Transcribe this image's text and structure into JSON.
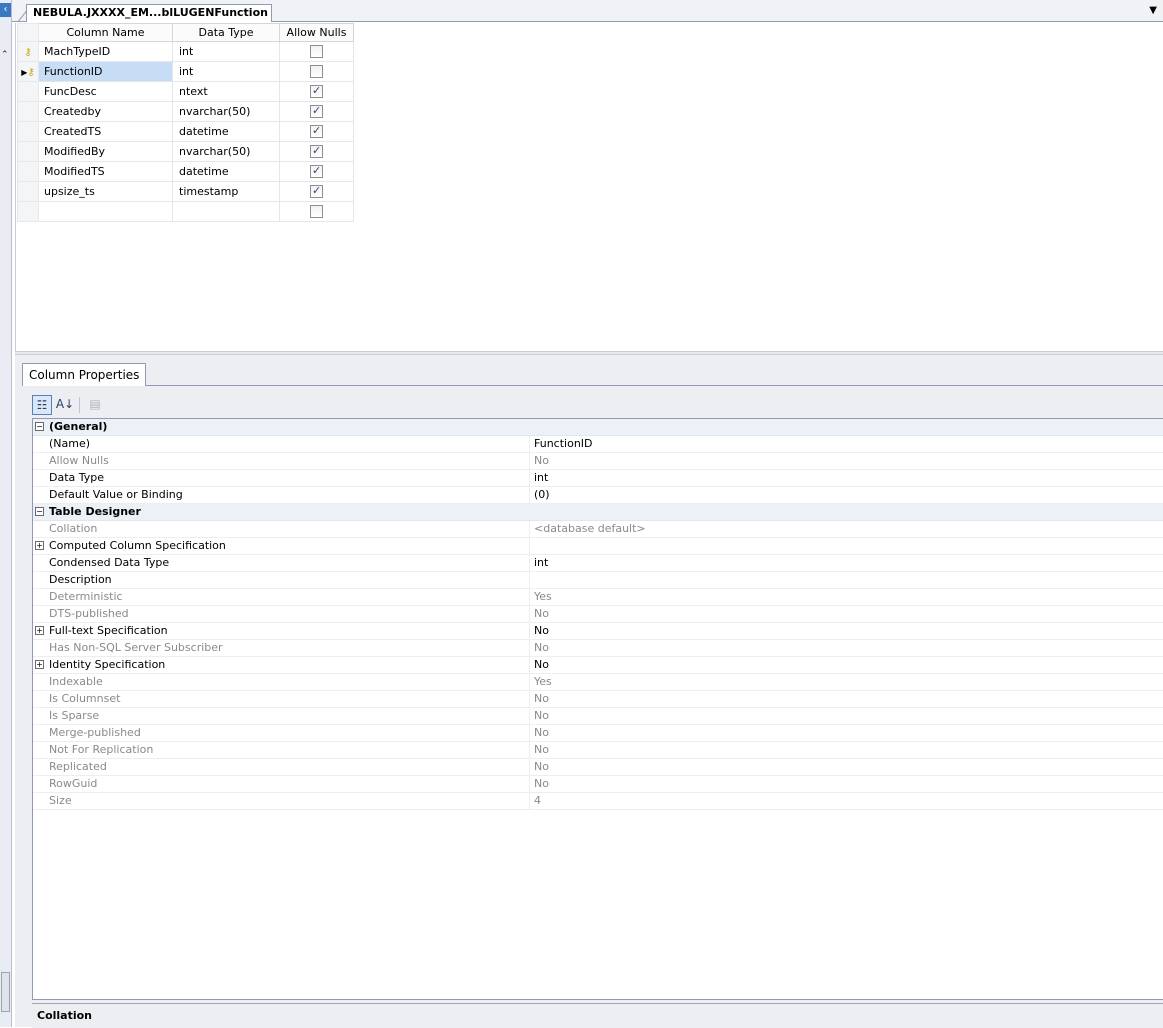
{
  "document_tab": {
    "title": "NEBULA.JXXXX_EM...blLUGENFunction"
  },
  "designer": {
    "headers": [
      "Column Name",
      "Data Type",
      "Allow Nulls"
    ],
    "rows": [
      {
        "marker": "key",
        "name": "MachTypeID",
        "type": "int",
        "allow_nulls": false
      },
      {
        "marker": "current-key",
        "name": "FunctionID",
        "type": "int",
        "allow_nulls": false
      },
      {
        "marker": "",
        "name": "FuncDesc",
        "type": "ntext",
        "allow_nulls": true
      },
      {
        "marker": "",
        "name": "Createdby",
        "type": "nvarchar(50)",
        "allow_nulls": true
      },
      {
        "marker": "",
        "name": "CreatedTS",
        "type": "datetime",
        "allow_nulls": true
      },
      {
        "marker": "",
        "name": "ModifiedBy",
        "type": "nvarchar(50)",
        "allow_nulls": true
      },
      {
        "marker": "",
        "name": "ModifiedTS",
        "type": "datetime",
        "allow_nulls": true
      },
      {
        "marker": "",
        "name": "upsize_ts",
        "type": "timestamp",
        "allow_nulls": true
      },
      {
        "marker": "",
        "name": "",
        "type": "",
        "allow_nulls": false
      }
    ]
  },
  "properties": {
    "tab_label": "Column Properties",
    "toolbar": {
      "categorized_icon": "categorized-icon",
      "alphabetical_icon": "sort-az-icon",
      "property_pages_icon": "property-pages-icon"
    },
    "sections": [
      {
        "title": "(General)",
        "rows": [
          {
            "name": "(Name)",
            "value": "FunctionID",
            "readonly": false,
            "expandable": false
          },
          {
            "name": "Allow Nulls",
            "value": "No",
            "readonly": true,
            "expandable": false
          },
          {
            "name": "Data Type",
            "value": "int",
            "readonly": false,
            "expandable": false
          },
          {
            "name": "Default Value or Binding",
            "value": "(0)",
            "readonly": false,
            "expandable": false
          }
        ]
      },
      {
        "title": "Table Designer",
        "rows": [
          {
            "name": "Collation",
            "value": "<database default>",
            "readonly": true,
            "expandable": false
          },
          {
            "name": "Computed Column Specification",
            "value": "",
            "readonly": false,
            "expandable": true
          },
          {
            "name": "Condensed Data Type",
            "value": "int",
            "readonly": false,
            "expandable": false
          },
          {
            "name": "Description",
            "value": "",
            "readonly": false,
            "expandable": false
          },
          {
            "name": "Deterministic",
            "value": "Yes",
            "readonly": true,
            "expandable": false
          },
          {
            "name": "DTS-published",
            "value": "No",
            "readonly": true,
            "expandable": false
          },
          {
            "name": "Full-text Specification",
            "value": "No",
            "readonly": false,
            "expandable": true
          },
          {
            "name": "Has Non-SQL Server Subscriber",
            "value": "No",
            "readonly": true,
            "expandable": false
          },
          {
            "name": "Identity Specification",
            "value": "No",
            "readonly": false,
            "expandable": true
          },
          {
            "name": "Indexable",
            "value": "Yes",
            "readonly": true,
            "expandable": false
          },
          {
            "name": "Is Columnset",
            "value": "No",
            "readonly": true,
            "expandable": false
          },
          {
            "name": "Is Sparse",
            "value": "No",
            "readonly": true,
            "expandable": false
          },
          {
            "name": "Merge-published",
            "value": "No",
            "readonly": true,
            "expandable": false
          },
          {
            "name": "Not For Replication",
            "value": "No",
            "readonly": true,
            "expandable": false
          },
          {
            "name": "Replicated",
            "value": "No",
            "readonly": true,
            "expandable": false
          },
          {
            "name": "RowGuid",
            "value": "No",
            "readonly": true,
            "expandable": false
          },
          {
            "name": "Size",
            "value": "4",
            "readonly": true,
            "expandable": false
          }
        ]
      }
    ],
    "description": {
      "title": "Collation"
    }
  }
}
